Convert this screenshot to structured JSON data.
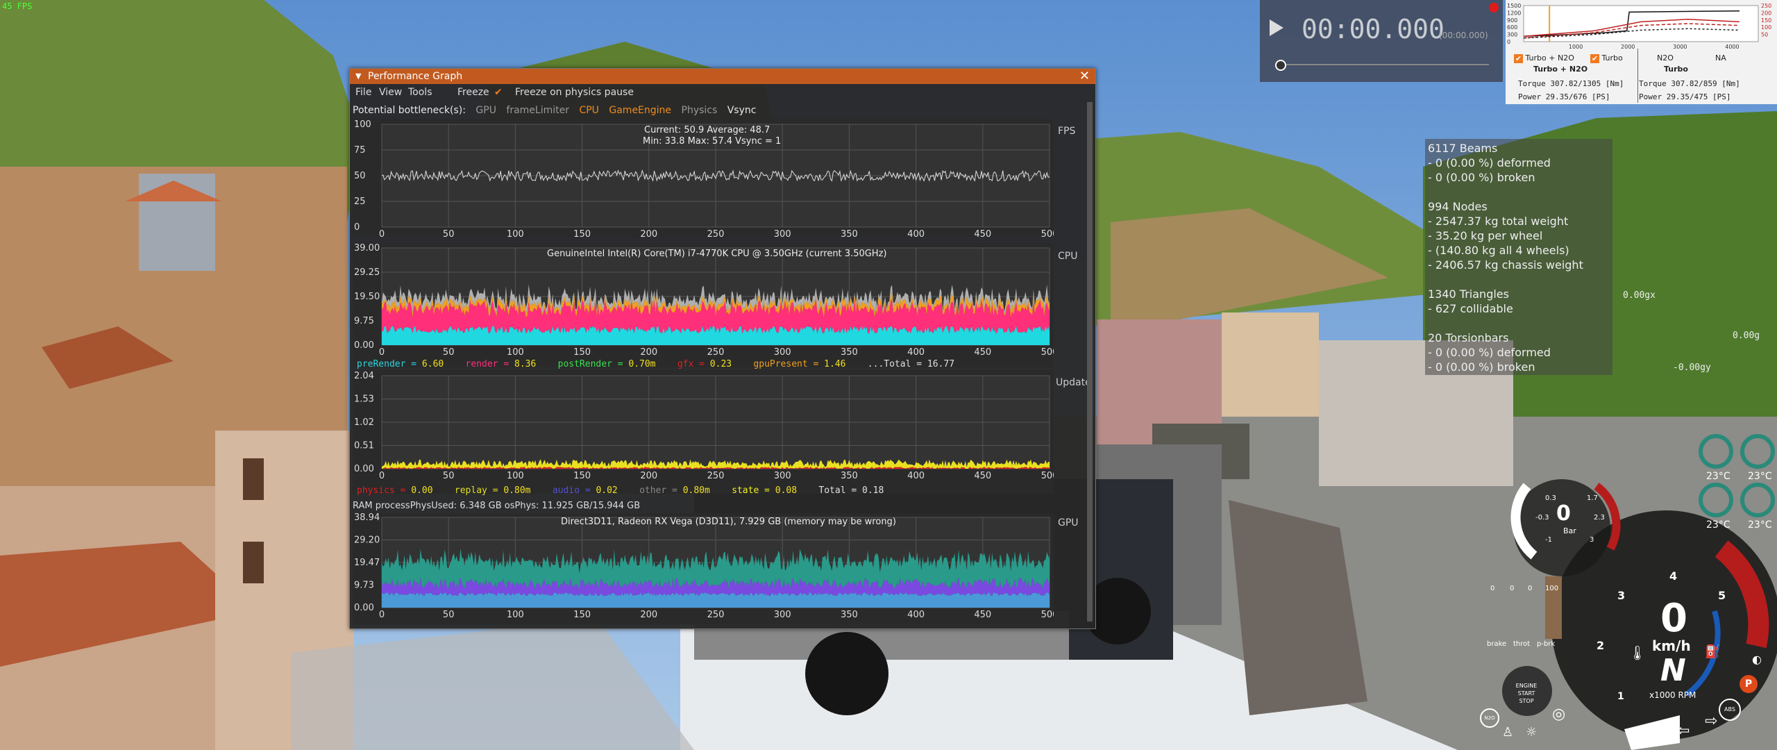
{
  "hud": {
    "fps_corner": "45 FPS"
  },
  "perf_window": {
    "title": "Performance Graph",
    "menu": {
      "file": "File",
      "view": "View",
      "tools": "Tools",
      "freeze": "Freeze",
      "freeze_on_pause": "Freeze on physics pause"
    },
    "bottleneck": {
      "label": "Potential bottleneck(s):",
      "items": [
        "GPU",
        "frameLimiter",
        "CPU",
        "GameEngine",
        "Physics",
        "Vsync"
      ]
    },
    "fps_plot": {
      "label": "FPS",
      "stats_line1": "Current: 50.9   Average: 48.7",
      "stats_line2": "Min: 33.8  Max: 57.4 Vsync = 1",
      "y_ticks": [
        "100",
        "75",
        "50",
        "25",
        "0"
      ]
    },
    "cpu_plot": {
      "label": "CPU",
      "header": "GenuineIntel Intel(R) Core(TM) i7-4770K CPU @ 3.50GHz (current 3.50GHz)",
      "y_ticks": [
        "39.00",
        "29.25",
        "19.50",
        "9.75",
        "0.00"
      ],
      "legend": [
        {
          "name": "preRender =",
          "value": "6.60",
          "color": "#2ad6e0"
        },
        {
          "name": "render =",
          "value": "8.36",
          "color": "#ff2f7a"
        },
        {
          "name": "postRender =",
          "value": "0.70m",
          "color": "#3ce050"
        },
        {
          "name": "gfx =",
          "value": "0.23",
          "color": "#e02020"
        },
        {
          "name": "gpuPresent =",
          "value": "1.46",
          "color": "#f0a020"
        }
      ],
      "total": "...Total = 16.77"
    },
    "update_plot": {
      "label": "Update",
      "y_ticks": [
        "2.04",
        "1.53",
        "1.02",
        "0.51",
        "0.00"
      ],
      "legend": [
        {
          "name": "physics =",
          "value": "0.00",
          "color": "#e02020"
        },
        {
          "name": "replay =",
          "value": "0.80m",
          "color": "#e0e020"
        },
        {
          "name": "audio =",
          "value": "0.02",
          "color": "#5050e0"
        },
        {
          "name": "other =",
          "value": "0.80m",
          "color": "#888888"
        },
        {
          "name": "state =",
          "value": "0.08",
          "color": "#f0f020"
        }
      ],
      "total": "Total = 0.18"
    },
    "ram_line": "RAM  processPhysUsed: 6.348 GB  osPhys: 11.925 GB/15.944 GB",
    "gpu_plot": {
      "label": "GPU",
      "header": "Direct3D11, Radeon RX Vega (D3D11), 7.929 GB (memory may be wrong)",
      "y_ticks": [
        "38.94",
        "29.20",
        "19.47",
        "9.73",
        "0.00"
      ]
    },
    "x_ticks": [
      "0",
      "50",
      "100",
      "150",
      "200",
      "250",
      "300",
      "350",
      "400",
      "450",
      "500"
    ]
  },
  "stopwatch": {
    "time": "00:00.000",
    "sub": "(00:00.000)"
  },
  "torque_panel": {
    "y_ticks": [
      "1500",
      "1200",
      "900",
      "600",
      "300",
      "0"
    ],
    "y2_ticks": [
      "250",
      "200",
      "150",
      "100",
      "50"
    ],
    "x_ticks": [
      "1000",
      "2000",
      "3000",
      "4000"
    ],
    "left": {
      "check_label": "Turbo + N2O",
      "mode": "Turbo + N2O",
      "torque": "Torque 307.82/1305 [Nm]",
      "power": "Power  29.35/676  [PS]"
    },
    "middle": {
      "check_label": "Turbo"
    },
    "right": {
      "check_a": "N2O",
      "check_b": "NA",
      "mode": "Turbo",
      "torque": "Torque 307.82/859 [Nm]",
      "power": "Power  29.35/475  [PS]"
    }
  },
  "beams_info": [
    "6117 Beams",
    "- 0 (0.00 %) deformed",
    "- 0 (0.00 %) broken",
    "",
    "994 Nodes",
    "- 2547.37 kg total weight",
    "- 35.20 kg per wheel",
    "- (140.80 kg all 4 wheels)",
    "- 2406.57 kg chassis weight",
    "",
    "1340 Triangles",
    "- 627 collidable",
    "",
    "20 Torsionbars",
    "- 0 (0.00 %) deformed",
    "- 0 (0.00 %) broken"
  ],
  "g_readouts": {
    "gx": "0.00gx",
    "g": "0.00g",
    "gy": "-0.00gy"
  },
  "tire_temps": [
    "23°C",
    "23°C",
    "23°C",
    "23°C"
  ],
  "dashboard": {
    "speed": "0",
    "speed_unit": "km/h",
    "gear": "N",
    "rpm_unit": "x1000 RPM",
    "boost": "0",
    "boost_unit": "Bar",
    "gauge_ticks": [
      "1",
      "2",
      "3",
      "4",
      "5"
    ],
    "small_ticks": [
      "0.3",
      "1.7",
      "-0.3",
      "2.3",
      "-1",
      "3"
    ],
    "slider_labels": [
      "0",
      "0",
      "0",
      "100"
    ],
    "control_labels": [
      "brake",
      "throt",
      "p-brk"
    ],
    "engine_button": {
      "line1": "ENGINE",
      "line2": "START",
      "line3": "STOP"
    },
    "indicator_p": "P",
    "indicator_abs": "ABS",
    "indicator_n2o": "N2O"
  },
  "colors": {
    "window_title": "#c25a1f",
    "accent": "#f07a20"
  }
}
